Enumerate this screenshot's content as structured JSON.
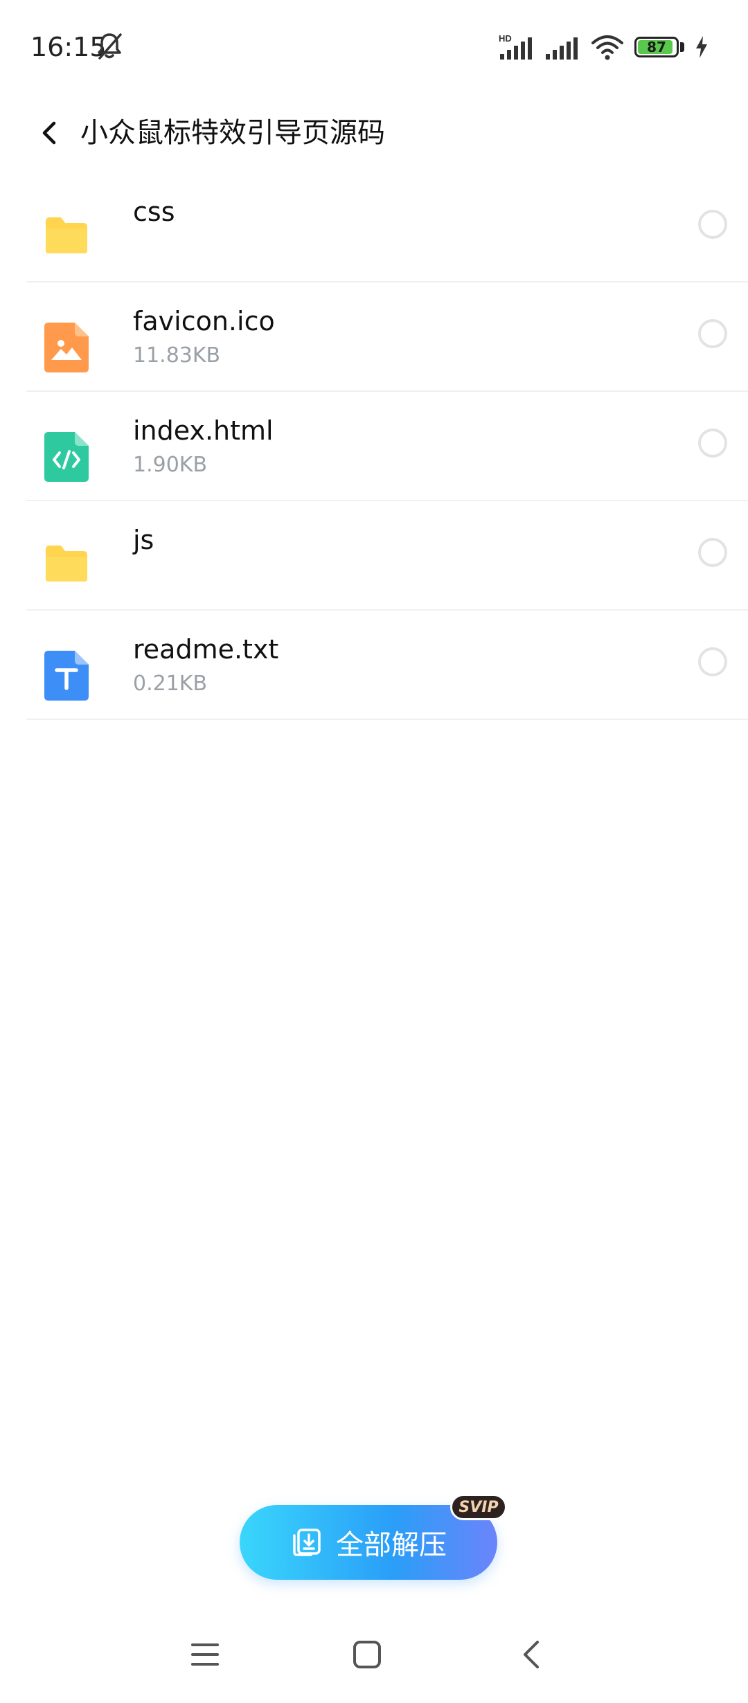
{
  "status_bar": {
    "time": "16:15",
    "network_label": "HD",
    "battery_level": "87"
  },
  "header": {
    "title": "小众鼠标特效引导页源码"
  },
  "files": [
    {
      "name": "css",
      "size": "",
      "type": "folder"
    },
    {
      "name": "favicon.ico",
      "size": "11.83KB",
      "type": "image"
    },
    {
      "name": "index.html",
      "size": "1.90KB",
      "type": "code"
    },
    {
      "name": "js",
      "size": "",
      "type": "folder"
    },
    {
      "name": "readme.txt",
      "size": "0.21KB",
      "type": "text"
    }
  ],
  "action": {
    "extract_label": "全部解压",
    "badge": "SVIP"
  },
  "colors": {
    "folder": "#FFD54F",
    "image_file": "#FF9A4D",
    "code_file": "#2FC9A0",
    "text_file": "#3D8EF6",
    "accent": "#2A9EF8"
  }
}
